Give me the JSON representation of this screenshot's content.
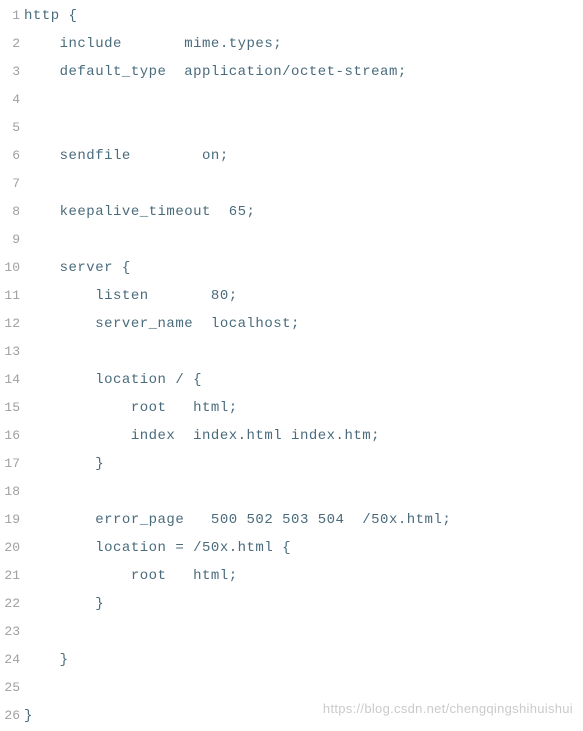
{
  "lines": [
    {
      "n": "1",
      "t": "http {"
    },
    {
      "n": "2",
      "t": "    include       mime.types;"
    },
    {
      "n": "3",
      "t": "    default_type  application/octet-stream;"
    },
    {
      "n": "4",
      "t": ""
    },
    {
      "n": "5",
      "t": ""
    },
    {
      "n": "6",
      "t": "    sendfile        on;"
    },
    {
      "n": "7",
      "t": ""
    },
    {
      "n": "8",
      "t": "    keepalive_timeout  65;"
    },
    {
      "n": "9",
      "t": ""
    },
    {
      "n": "10",
      "t": "    server {"
    },
    {
      "n": "11",
      "t": "        listen       80;"
    },
    {
      "n": "12",
      "t": "        server_name  localhost;"
    },
    {
      "n": "13",
      "t": ""
    },
    {
      "n": "14",
      "t": "        location / {"
    },
    {
      "n": "15",
      "t": "            root   html;"
    },
    {
      "n": "16",
      "t": "            index  index.html index.htm;"
    },
    {
      "n": "17",
      "t": "        }"
    },
    {
      "n": "18",
      "t": ""
    },
    {
      "n": "19",
      "t": "        error_page   500 502 503 504  /50x.html;"
    },
    {
      "n": "20",
      "t": "        location = /50x.html {"
    },
    {
      "n": "21",
      "t": "            root   html;"
    },
    {
      "n": "22",
      "t": "        }"
    },
    {
      "n": "23",
      "t": ""
    },
    {
      "n": "24",
      "t": "    }"
    },
    {
      "n": "25",
      "t": ""
    },
    {
      "n": "26",
      "t": "}"
    }
  ],
  "watermark": "https://blog.csdn.net/chengqingshihuishui"
}
